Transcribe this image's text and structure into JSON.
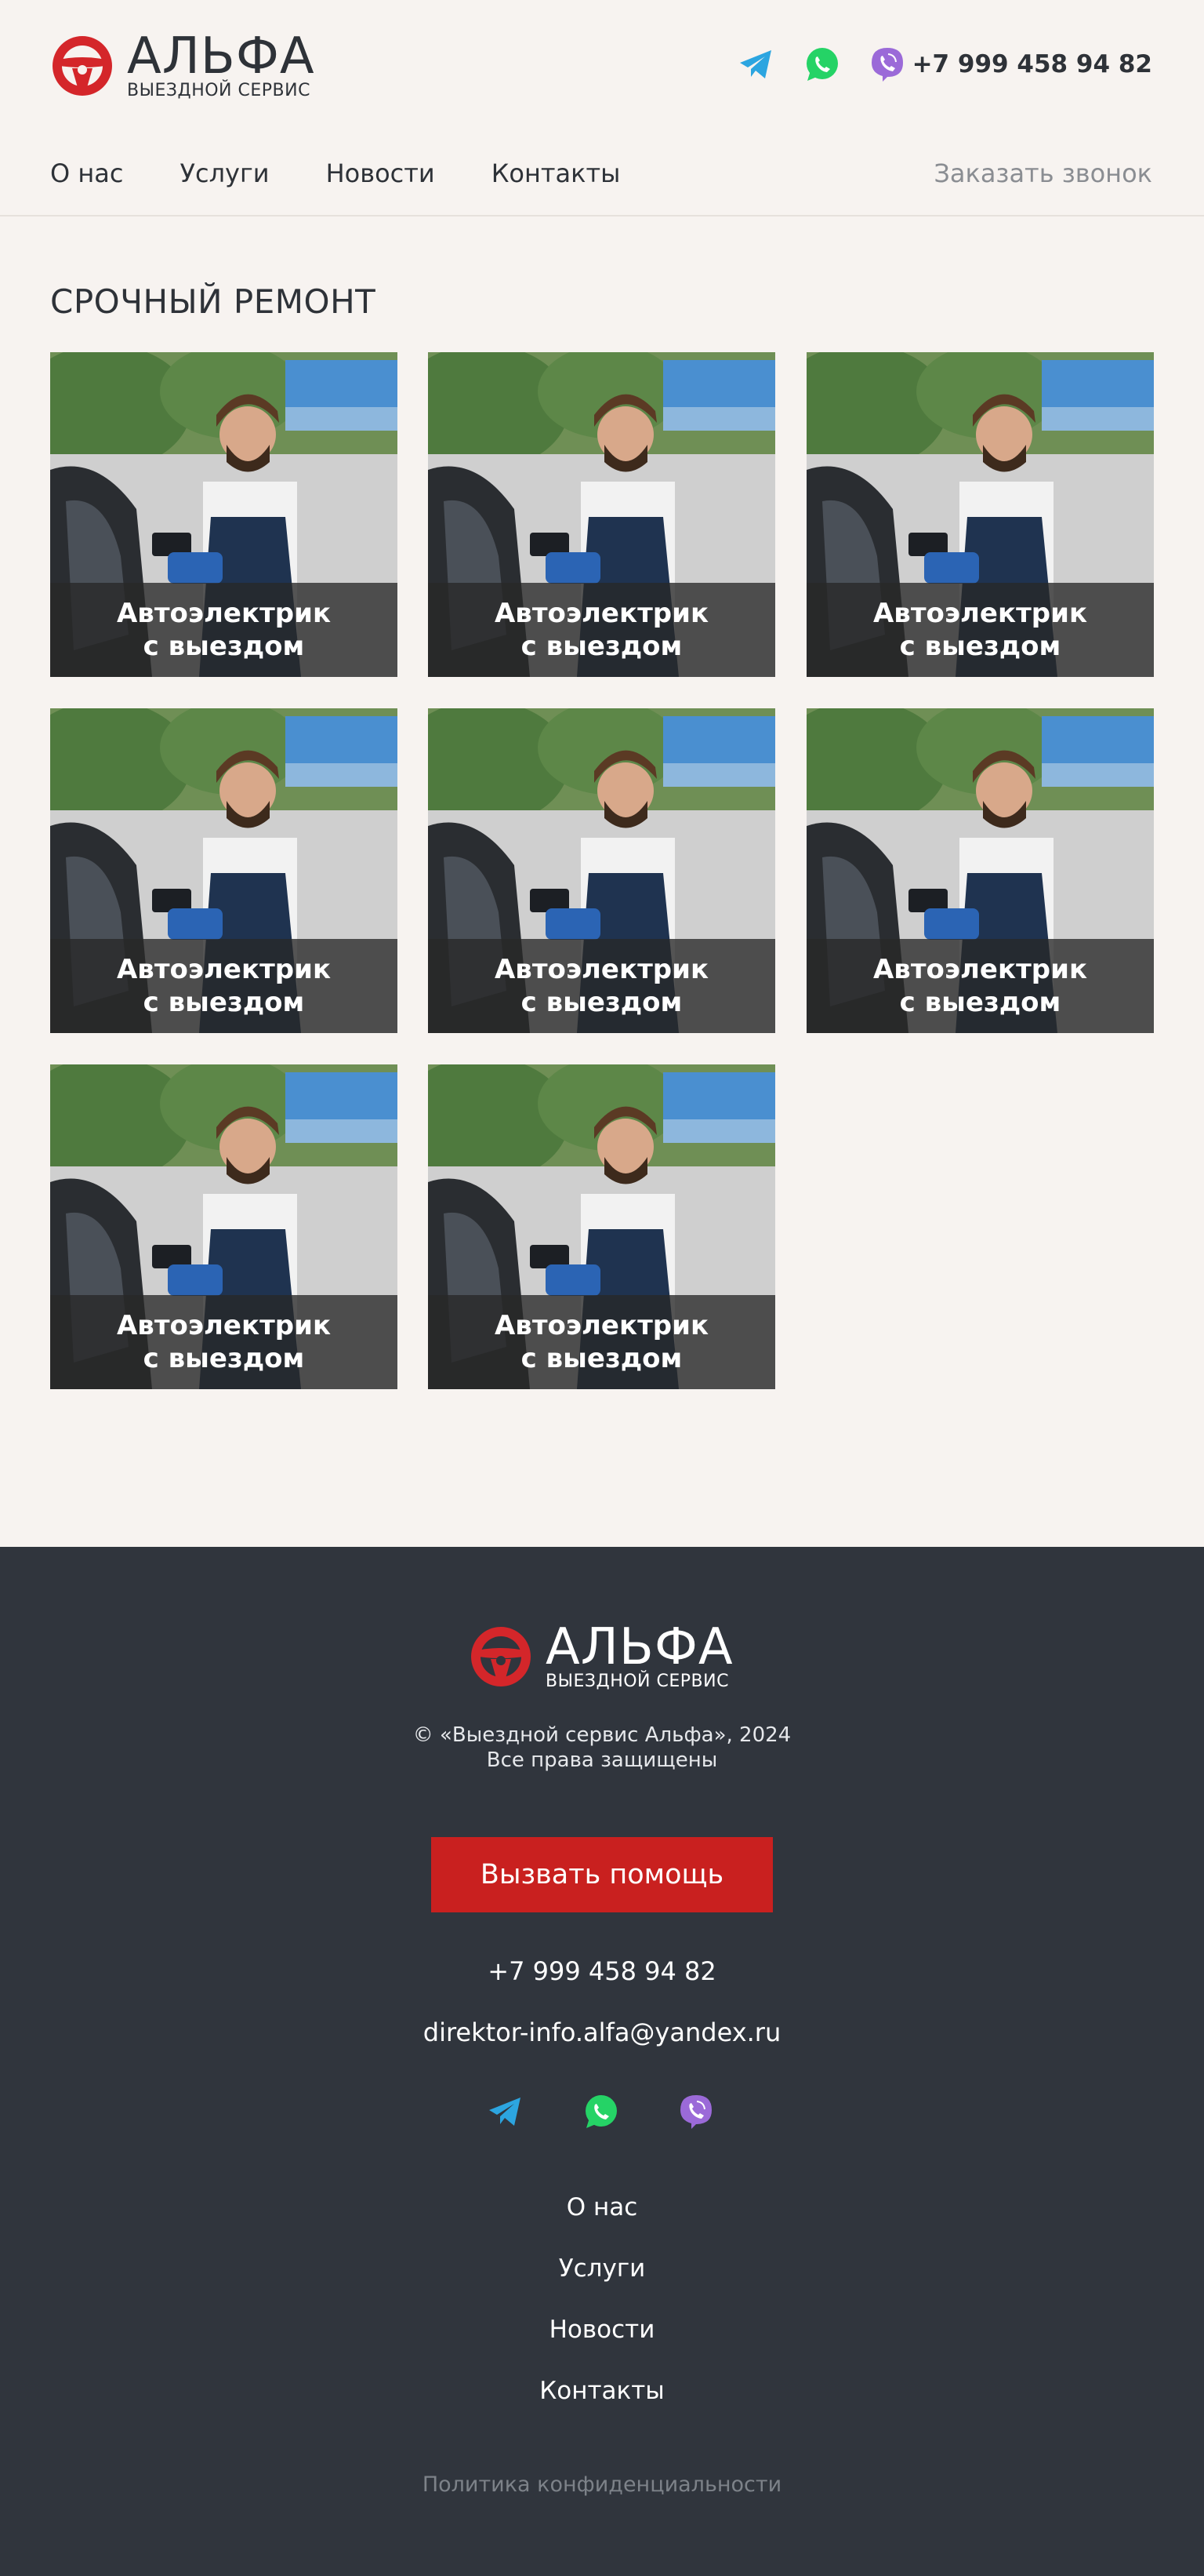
{
  "brand": {
    "name": "АЛЬФА",
    "tagline": "ВЫЕЗДНОЙ СЕРВИС",
    "accent": "#d4262a"
  },
  "header": {
    "socials": [
      {
        "icon": "telegram-icon",
        "color": "#2ca5e0"
      },
      {
        "icon": "whatsapp-icon",
        "color": "#25d366"
      },
      {
        "icon": "viber-icon",
        "color": "#9b6ad8"
      }
    ],
    "phone": "+7 999 458 94 82",
    "nav": [
      "О нас",
      "Услуги",
      "Новости",
      "Контакты"
    ],
    "callback": "Заказать звонок"
  },
  "main": {
    "title": "СРОЧНЫЙ РЕМОНТ",
    "cards": [
      {
        "line1": "Автоэлектрик",
        "line2": "с выездом"
      },
      {
        "line1": "Автоэлектрик",
        "line2": "с выездом"
      },
      {
        "line1": "Автоэлектрик",
        "line2": "с выездом"
      },
      {
        "line1": "Автоэлектрик",
        "line2": "с выездом"
      },
      {
        "line1": "Автоэлектрик",
        "line2": "с выездом"
      },
      {
        "line1": "Автоэлектрик",
        "line2": "с выездом"
      },
      {
        "line1": "Автоэлектрик",
        "line2": "с выездом"
      },
      {
        "line1": "Автоэлектрик",
        "line2": "с выездом"
      }
    ]
  },
  "footer": {
    "copyright": "© «Выездной сервис Альфа», 2024",
    "rights": "Все права защищены",
    "cta": "Вызвать помощь",
    "cta_color": "#c9201f",
    "phone": "+7 999 458 94 82",
    "email": "direktor-info.alfa@yandex.ru",
    "nav": [
      "О нас",
      "Услуги",
      "Новости",
      "Контакты"
    ],
    "policy": "Политика конфиденциальности"
  }
}
